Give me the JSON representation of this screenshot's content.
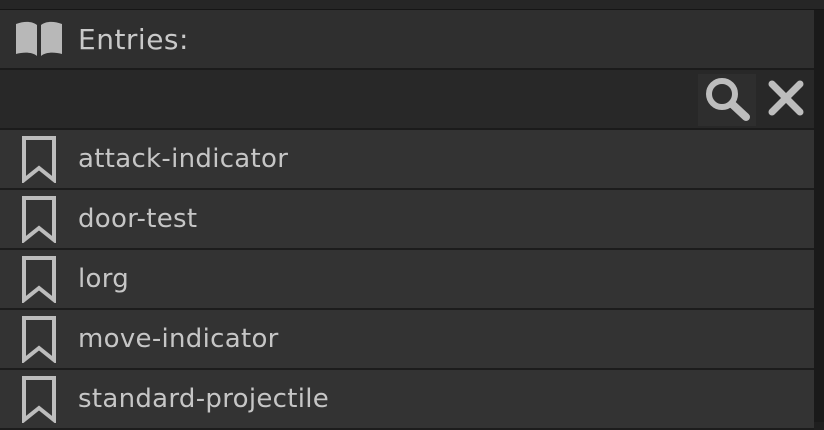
{
  "header": {
    "title": "Entries:",
    "icon": "book-icon"
  },
  "search": {
    "value": "",
    "placeholder": "",
    "search_icon": "search-icon",
    "clear_icon": "close-icon"
  },
  "entries": [
    {
      "label": "attack-indicator",
      "icon": "bookmark-icon"
    },
    {
      "label": "door-test",
      "icon": "bookmark-icon"
    },
    {
      "label": "lorg",
      "icon": "bookmark-icon"
    },
    {
      "label": "move-indicator",
      "icon": "bookmark-icon"
    },
    {
      "label": "standard-projectile",
      "icon": "bookmark-icon"
    }
  ],
  "colors": {
    "background": "#1e1e1e",
    "header": "#2f2f2f",
    "row": "#333333",
    "text": "#c6c6c6",
    "icon": "#bdbdbd"
  }
}
